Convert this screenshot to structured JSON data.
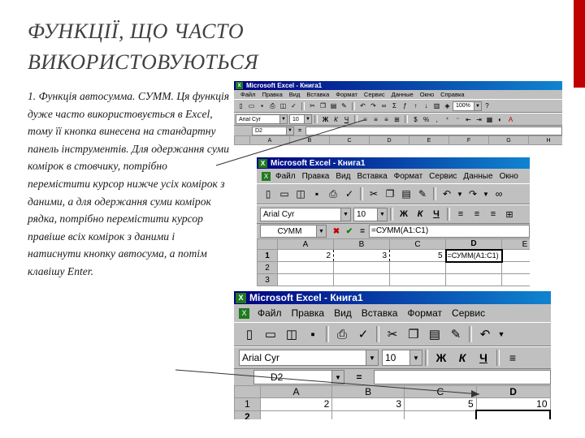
{
  "title": {
    "line1": "ФУНКЦІЇ, ЩО ЧАСТО",
    "line2": "ВИКОРИСТОВУЮТЬСЯ"
  },
  "body_text": "1. Функція автосумма. СУММ. Ця функція дуже часто використовується в Excel, тому її кнопка винесена на стандартну панель інструментів. Для одержання суми комірок в стовчику, потрібно перемістити курсор нижче усіх комірок з даними, а для одержання суми комірок рядка, потрібно перемістити курсор правіше всіх комірок з даними і натиснути кнопку автосума, а потім клавішу Enter.",
  "colors": {
    "accent_red": "#c00000",
    "titlebar": "#000080",
    "excel_green": "#1f7a1f"
  },
  "win1": {
    "title": "Microsoft Excel - Книга1",
    "menu": [
      "Файл",
      "Правка",
      "Вид",
      "Вставка",
      "Формат",
      "Сервис",
      "Данные",
      "Окно",
      "Справка"
    ],
    "zoom": "100%",
    "font_name": "Arial Cyr",
    "font_size": "10",
    "name_box": "D2",
    "columns": [
      "A",
      "B",
      "C",
      "D",
      "E",
      "F",
      "G",
      "H"
    ]
  },
  "win2": {
    "title": "Microsoft Excel - Книга1",
    "menu": [
      "Файл",
      "Правка",
      "Вид",
      "Вставка",
      "Формат",
      "Сервис",
      "Данные",
      "Окно"
    ],
    "font_name": "Arial Cyr",
    "font_size": "10",
    "bold": "Ж",
    "italic": "К",
    "underline": "Ч",
    "name_box": "СУММ",
    "cancel": "✖",
    "confirm": "✔",
    "fx": "=",
    "formula": "=СУММ(A1:C1)",
    "columns": [
      "A",
      "B",
      "C",
      "D",
      "E"
    ],
    "rows": [
      {
        "n": "1",
        "cells": [
          "2",
          "3",
          "5",
          "=СУММ(A1:C1)"
        ]
      },
      {
        "n": "2",
        "cells": [
          "",
          "",
          "",
          ""
        ]
      },
      {
        "n": "3",
        "cells": [
          "",
          "",
          "",
          ""
        ]
      }
    ]
  },
  "win3": {
    "title": "Microsoft Excel - Книга1",
    "menu": [
      "Файл",
      "Правка",
      "Вид",
      "Вставка",
      "Формат",
      "Сервис"
    ],
    "font_name": "Arial Cyr",
    "font_size": "10",
    "bold": "Ж",
    "italic": "К",
    "underline": "Ч",
    "name_box": "D2",
    "fx": "=",
    "columns": [
      "A",
      "B",
      "C",
      "D"
    ],
    "rows": [
      {
        "n": "1",
        "cells": [
          "2",
          "3",
          "5",
          "10"
        ]
      },
      {
        "n": "2",
        "cells": [
          "",
          "",
          "",
          ""
        ]
      }
    ]
  }
}
